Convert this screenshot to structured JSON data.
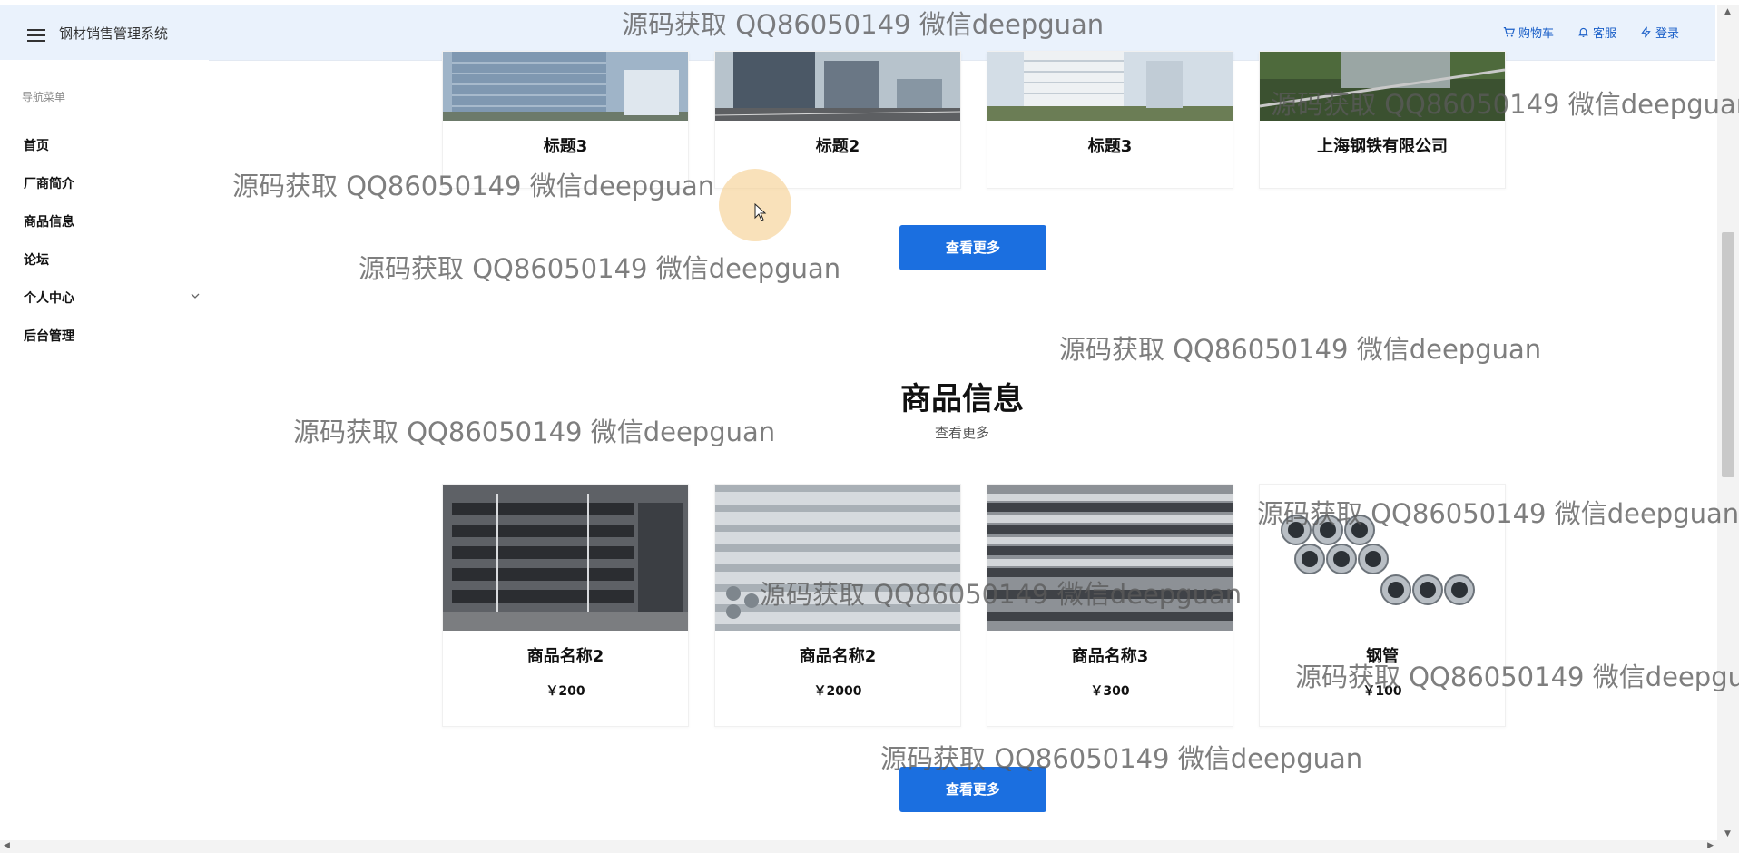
{
  "header": {
    "app_title": "钢材销售管理系统",
    "links": [
      {
        "label": "购物车",
        "icon": "cart-icon"
      },
      {
        "label": "客服",
        "icon": "bell-icon"
      },
      {
        "label": "登录",
        "icon": "bolt-icon"
      }
    ]
  },
  "sidebar": {
    "title": "导航菜单",
    "items": [
      {
        "label": "首页"
      },
      {
        "label": "厂商简介"
      },
      {
        "label": "商品信息"
      },
      {
        "label": "论坛"
      },
      {
        "label": "个人中心",
        "has_submenu": true
      },
      {
        "label": "后台管理"
      }
    ]
  },
  "news_section": {
    "cards": [
      {
        "title": "标题3"
      },
      {
        "title": "标题2"
      },
      {
        "title": "标题3"
      },
      {
        "title": "上海钢铁有限公司"
      }
    ],
    "more_button": "查看更多"
  },
  "product_section": {
    "title": "商品信息",
    "subtitle_link": "查看更多",
    "cards": [
      {
        "name": "商品名称2",
        "price": "￥200"
      },
      {
        "name": "商品名称2",
        "price": "￥2000"
      },
      {
        "name": "商品名称3",
        "price": "￥300"
      },
      {
        "name": "钢管",
        "price": "￥100"
      }
    ],
    "more_button": "查看更多"
  },
  "watermark": "源码获取 QQ86050149 微信deepguan",
  "colors": {
    "header_bg": "#eaf2fc",
    "primary": "#1b6fe0",
    "link": "#1a5fc8"
  }
}
